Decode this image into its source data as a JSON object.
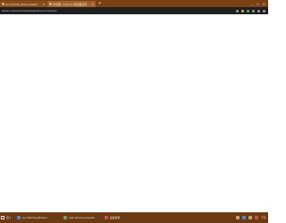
{
  "browser": {
    "tabs": [
      {
        "title": "Go (TG/CS) github.io/path/...",
        "active": false
      },
      {
        "title": "浏览器 - Chrome 浏览器空间",
        "active": true
      }
    ],
    "new_tab_label": "+",
    "url": "tabtab.edu/kaizcin/abashiadv/devmemo/admin"
  },
  "taskbar": {
    "start_label": "田 1",
    "items": [
      {
        "label": "Go (TG/CS) github.io",
        "color": "#4a8bd4"
      },
      {
        "label": "trello drive/co.ed.pack",
        "color": "#6aa66a"
      },
      {
        "label": "设备搜索",
        "color": "#d0504a"
      }
    ],
    "clock": "下午"
  },
  "colors": {
    "tab_strip": "#7a4213",
    "toolbar": "#1f1f1f",
    "taskbar": "#6b3a12"
  }
}
